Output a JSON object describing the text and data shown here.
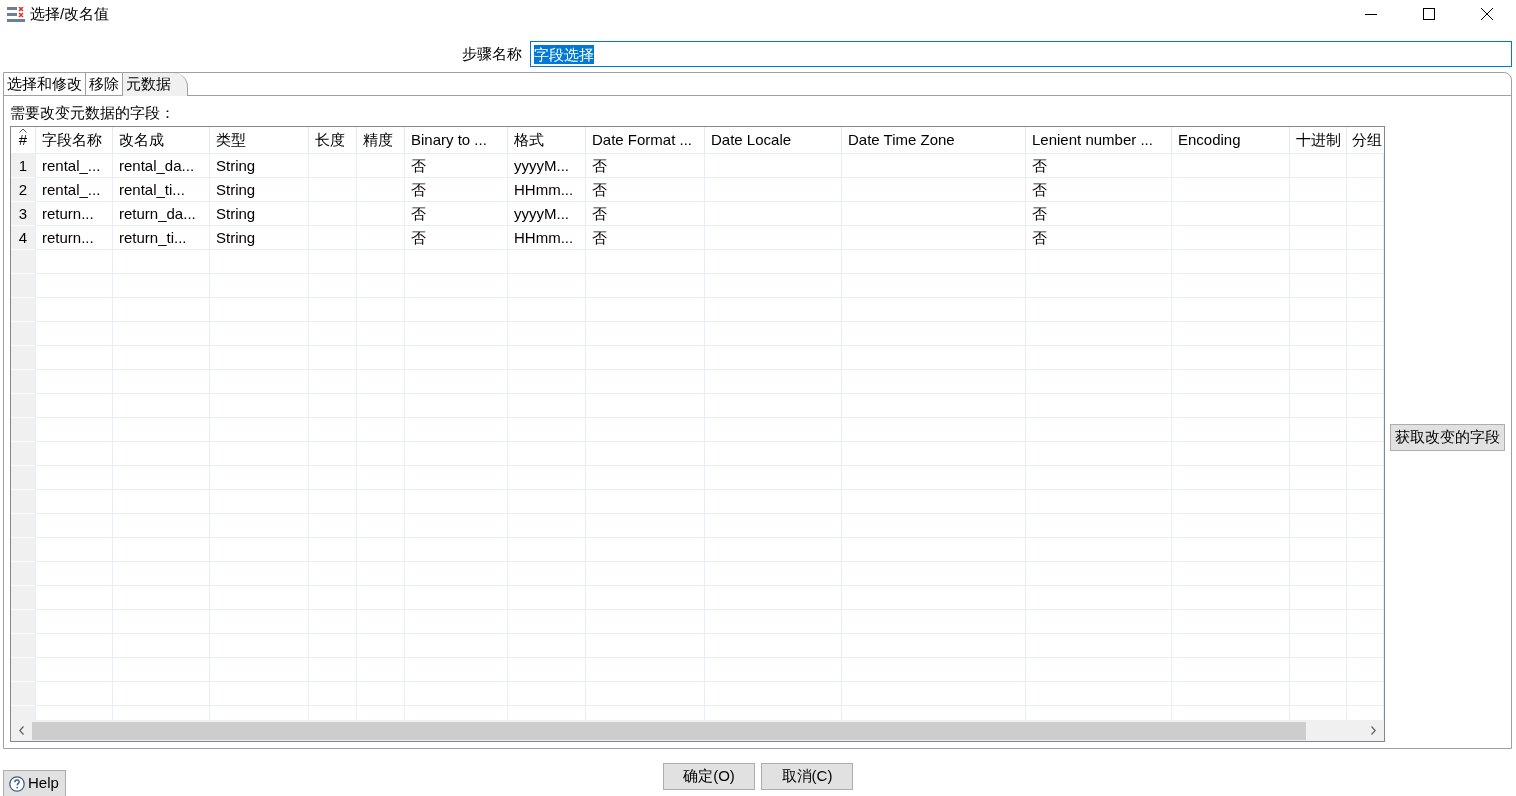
{
  "window": {
    "title": "选择/改名值"
  },
  "step_name": {
    "label": "步骤名称",
    "value": "字段选择",
    "text_selected": true
  },
  "tabs": [
    {
      "label": "选择和修改",
      "selected": false
    },
    {
      "label": "移除",
      "selected": false
    },
    {
      "label": "元数据",
      "selected": true
    }
  ],
  "panel": {
    "label": "需要改变元数据的字段：",
    "get_fields_button": "获取改变的字段"
  },
  "table": {
    "columns": [
      {
        "label": "#",
        "sorted": true
      },
      {
        "label": "字段名称",
        "sorted": false
      },
      {
        "label": "改名成",
        "sorted": false
      },
      {
        "label": "类型",
        "sorted": false
      },
      {
        "label": "长度",
        "sorted": false
      },
      {
        "label": "精度",
        "sorted": false
      },
      {
        "label": "Binary to ...",
        "sorted": false
      },
      {
        "label": "格式",
        "sorted": false
      },
      {
        "label": "Date Format ...",
        "sorted": false
      },
      {
        "label": "Date Locale",
        "sorted": false
      },
      {
        "label": "Date Time Zone",
        "sorted": false
      },
      {
        "label": "Lenient number ...",
        "sorted": false
      },
      {
        "label": "Encoding",
        "sorted": false
      },
      {
        "label": "十进制",
        "sorted": false
      },
      {
        "label": "分组",
        "sorted": false
      }
    ],
    "rows": [
      {
        "number": "1",
        "field_name": "rental_...",
        "rename_to": "rental_da...",
        "type": "String",
        "binary_to": "否",
        "format": "yyyyM...",
        "date_format": "否",
        "lenient_number": "否"
      },
      {
        "number": "2",
        "field_name": "rental_...",
        "rename_to": "rental_ti...",
        "type": "String",
        "binary_to": "否",
        "format": "HHmm...",
        "date_format": "否",
        "lenient_number": "否"
      },
      {
        "number": "3",
        "field_name": "return...",
        "rename_to": "return_da...",
        "type": "String",
        "binary_to": "否",
        "format": "yyyyM...",
        "date_format": "否",
        "lenient_number": "否"
      },
      {
        "number": "4",
        "field_name": "return...",
        "rename_to": "return_ti...",
        "type": "String",
        "binary_to": "否",
        "format": "HHmm...",
        "date_format": "否",
        "lenient_number": "否"
      }
    ]
  },
  "buttons": [
    {
      "label": "确定(O)"
    },
    {
      "label": "取消(C)"
    }
  ],
  "help_button": {
    "label": "Help"
  }
}
